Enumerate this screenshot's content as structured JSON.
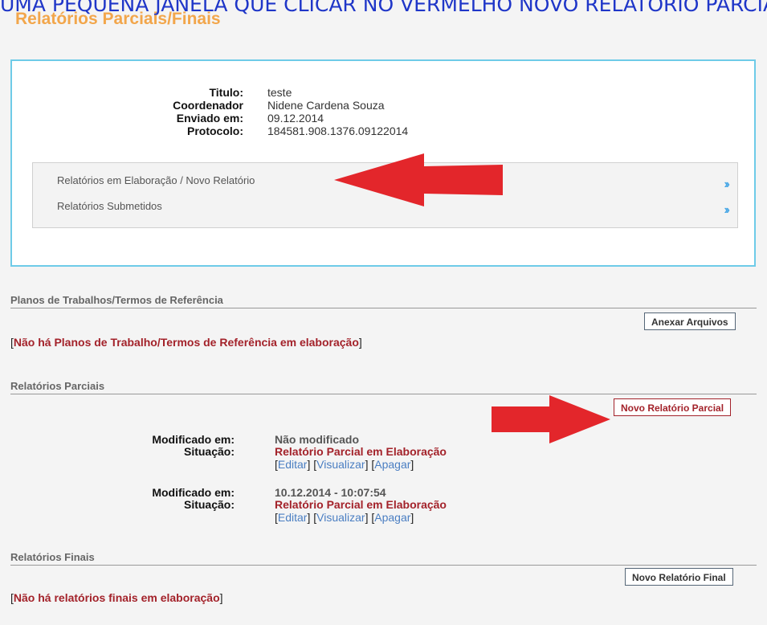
{
  "overlay_caption": "UMA PEQUENA JANELA QUE CLICAR NO VERMELHO NOVO RELATÓRIO PARCIAL",
  "page_title": "Relatórios Parciais/Finais",
  "info": {
    "rows": [
      {
        "label": "Titulo:",
        "value": "teste"
      },
      {
        "label": "Coordenador",
        "value": "Nidene Cardena Souza"
      },
      {
        "label": "Enviado em:",
        "value": "09.12.2014"
      },
      {
        "label": "Protocolo:",
        "value": "184581.908.1376.09122014"
      }
    ]
  },
  "menu": {
    "items": [
      {
        "label": "Relatórios em Elaboração / Novo Relatório"
      },
      {
        "label": "Relatórios Submetidos"
      }
    ]
  },
  "sections": {
    "planos": {
      "title": "Planos de Trabalhos/Termos de Referência",
      "button": "Anexar Arquivos",
      "notice": "Não há Planos de Trabalho/Termos de Referência em elaboração"
    },
    "parciais": {
      "title": "Relatórios Parciais",
      "button": "Novo Relatório Parcial",
      "entries": [
        {
          "modified_label": "Modificado em:",
          "modified_value": "Não modificado",
          "status_label": "Situação:",
          "status_value": "Relatório Parcial em Elaboração",
          "actions": [
            "Editar",
            "Visualizar",
            "Apagar"
          ]
        },
        {
          "modified_label": "Modificado em:",
          "modified_value": "10.12.2014 - 10:07:54",
          "status_label": "Situação:",
          "status_value": "Relatório Parcial em Elaboração",
          "actions": [
            "Editar",
            "Visualizar",
            "Apagar"
          ]
        }
      ]
    },
    "finais": {
      "title": "Relatórios Finais",
      "button": "Novo Relatório Final",
      "notice": "Não há relatórios finais em elaboração"
    }
  },
  "colors": {
    "title_orange": "#f2a64b",
    "box_border": "#6ecbe8",
    "dark_red": "#a3222a",
    "arrow_red": "#e3262b",
    "link_blue": "#4a7ec2",
    "chevron_blue": "#4aa8e6"
  }
}
